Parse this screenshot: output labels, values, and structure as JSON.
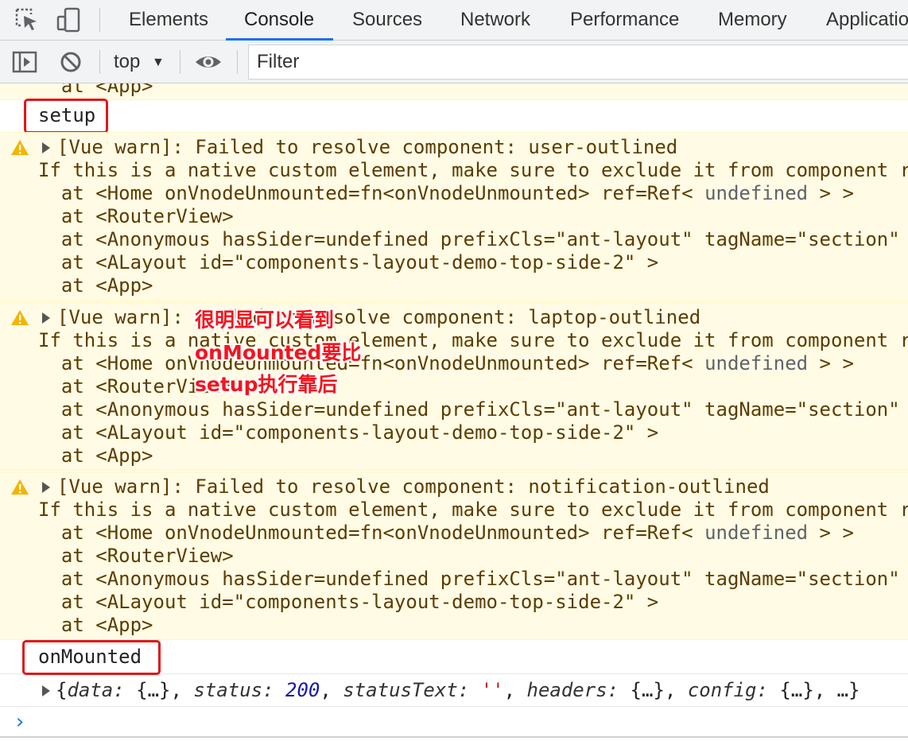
{
  "tabs": [
    {
      "label": "Elements"
    },
    {
      "label": "Console",
      "active": true
    },
    {
      "label": "Sources"
    },
    {
      "label": "Network"
    },
    {
      "label": "Performance"
    },
    {
      "label": "Memory"
    },
    {
      "label": "Applicatio"
    }
  ],
  "toolbar": {
    "context": "top",
    "filter_placeholder": "Filter"
  },
  "console": {
    "top_partial": "  at <App>",
    "setup_log": "setup",
    "warnings": [
      {
        "title": "[Vue warn]: Failed to resolve component: user-outlined",
        "hint": "If this is a native custom element, make sure to exclude it from component r",
        "home_prefix": "  at <Home onVnodeUnmounted=fn<onVnodeUnmounted> ref=Ref< ",
        "home_undefined": "undefined",
        "home_suffix": " > >",
        "router": "  at <RouterView>",
        "anon": "  at <Anonymous hasSider=undefined prefixCls=\"ant-layout\" tagName=\"section\" ",
        "alayout": "  at <ALayout id=\"components-layout-demo-top-side-2\" >",
        "app": "  at <App>"
      },
      {
        "title": "[Vue warn]: Failed to resolve component: laptop-outlined",
        "hint": "If this is a native custom element, make sure to exclude it from component r",
        "home_prefix": "  at <Home onVnodeUnmounted=fn<onVnodeUnmounted> ref=Ref< ",
        "home_undefined": "undefined",
        "home_suffix": " > >",
        "router": "  at <RouterView>",
        "anon": "  at <Anonymous hasSider=undefined prefixCls=\"ant-layout\" tagName=\"section\" ",
        "alayout": "  at <ALayout id=\"components-layout-demo-top-side-2\" >",
        "app": "  at <App>"
      },
      {
        "title": "[Vue warn]: Failed to resolve component: notification-outlined",
        "hint": "If this is a native custom element, make sure to exclude it from component r",
        "home_prefix": "  at <Home onVnodeUnmounted=fn<onVnodeUnmounted> ref=Ref< ",
        "home_undefined": "undefined",
        "home_suffix": " > >",
        "router": "  at <RouterView>",
        "anon": "  at <Anonymous hasSider=undefined prefixCls=\"ant-layout\" tagName=\"section\" ",
        "alayout": "  at <ALayout id=\"components-layout-demo-top-side-2\" >",
        "app": "  at <App>"
      }
    ],
    "mounted_log": "onMounted",
    "response": {
      "open": "{",
      "k1": "data",
      "v1": " {…}, ",
      "k2": "status",
      "v2": "200",
      "k3": "statusText",
      "v3": "''",
      "k4": "headers",
      "v4": " {…}, ",
      "k5": "config",
      "v5": " {…}, …}"
    },
    "prompt": "›"
  },
  "annotation": {
    "lines": [
      "很明显可以看到",
      "onMounted要比",
      "setup执行靠后"
    ]
  },
  "colors": {
    "accent": "#1a73e8",
    "warn_bg": "#fffbe5",
    "annotation_red": "#e01818"
  }
}
